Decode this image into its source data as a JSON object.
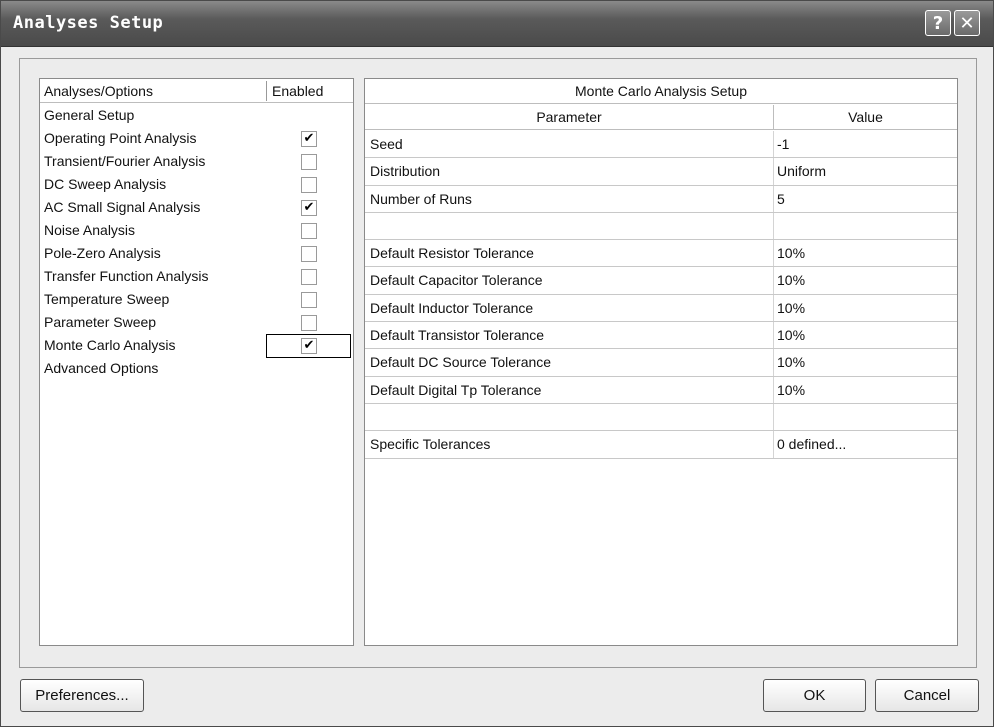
{
  "window": {
    "title": "Analyses Setup",
    "help_glyph": "?",
    "close_glyph": "✕"
  },
  "left_panel": {
    "header_analyses": "Analyses/Options",
    "header_enabled": "Enabled",
    "items": [
      {
        "label": "General Setup",
        "has_checkbox": false,
        "checked": false
      },
      {
        "label": "Operating Point Analysis",
        "has_checkbox": true,
        "checked": true
      },
      {
        "label": "Transient/Fourier Analysis",
        "has_checkbox": true,
        "checked": false
      },
      {
        "label": "DC Sweep Analysis",
        "has_checkbox": true,
        "checked": false
      },
      {
        "label": "AC Small Signal Analysis",
        "has_checkbox": true,
        "checked": true
      },
      {
        "label": "Noise Analysis",
        "has_checkbox": true,
        "checked": false
      },
      {
        "label": "Pole-Zero Analysis",
        "has_checkbox": true,
        "checked": false
      },
      {
        "label": "Transfer Function Analysis",
        "has_checkbox": true,
        "checked": false
      },
      {
        "label": "Temperature Sweep",
        "has_checkbox": true,
        "checked": false
      },
      {
        "label": "Parameter Sweep",
        "has_checkbox": true,
        "checked": false
      },
      {
        "label": "Monte Carlo Analysis",
        "has_checkbox": true,
        "checked": true,
        "focused": true
      },
      {
        "label": "Advanced Options",
        "has_checkbox": false,
        "checked": false
      }
    ]
  },
  "right_panel": {
    "title": "Monte Carlo Analysis Setup",
    "col_parameter": "Parameter",
    "col_value": "Value",
    "rows": [
      {
        "parameter": "Seed",
        "value": "-1"
      },
      {
        "parameter": "Distribution",
        "value": "Uniform"
      },
      {
        "parameter": "Number of Runs",
        "value": "5"
      },
      {
        "parameter": "",
        "value": ""
      },
      {
        "parameter": "Default Resistor Tolerance",
        "value": "10%"
      },
      {
        "parameter": "Default Capacitor Tolerance",
        "value": "10%"
      },
      {
        "parameter": "Default Inductor Tolerance",
        "value": "10%"
      },
      {
        "parameter": "Default Transistor Tolerance",
        "value": "10%"
      },
      {
        "parameter": "Default DC Source Tolerance",
        "value": "10%"
      },
      {
        "parameter": "Default Digital Tp Tolerance",
        "value": "10%"
      },
      {
        "parameter": "",
        "value": ""
      },
      {
        "parameter": "Specific Tolerances",
        "value": "0 defined..."
      }
    ]
  },
  "buttons": {
    "preferences": "Preferences...",
    "ok": "OK",
    "cancel": "Cancel"
  },
  "check_glyph": "✔"
}
